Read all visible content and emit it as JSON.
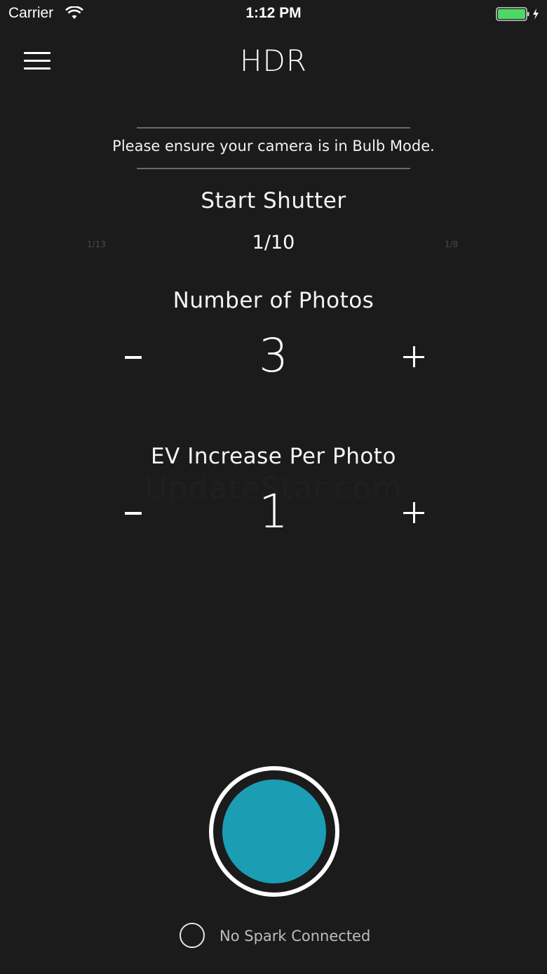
{
  "status_bar": {
    "carrier": "Carrier",
    "time": "1:12 PM",
    "battery_color": "#4cd964"
  },
  "header": {
    "title": "HDR",
    "menu_icon": "hamburger-menu-icon"
  },
  "notice": "Please ensure your camera is in Bulb Mode.",
  "start_shutter": {
    "label": "Start Shutter",
    "previous": "1/13",
    "current": "1/10",
    "next": "1/8"
  },
  "photos": {
    "label": "Number of Photos",
    "value": "3",
    "decrement": "minus-icon",
    "increment": "plus-icon"
  },
  "ev": {
    "label": "EV Increase Per Photo",
    "value": "1",
    "decrement": "minus-icon",
    "increment": "plus-icon"
  },
  "watermark": "UpdateStar.com",
  "shutter_button": {
    "accent": "#1b9db3"
  },
  "connection": {
    "status": "No Spark Connected"
  }
}
